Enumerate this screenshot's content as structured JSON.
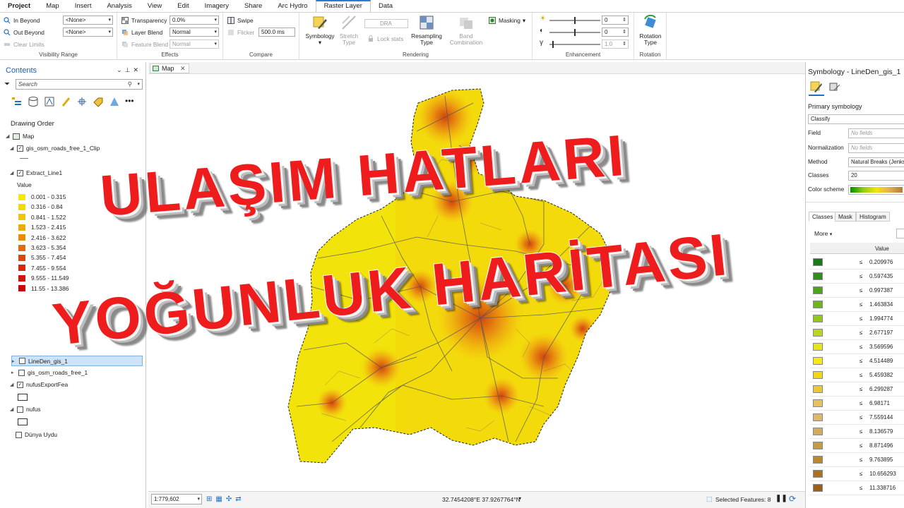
{
  "ribbon": {
    "tabs": [
      "Project",
      "Map",
      "Insert",
      "Analysis",
      "View",
      "Edit",
      "Imagery",
      "Share",
      "Arc Hydro",
      "Raster Layer",
      "Data"
    ],
    "active_tab": "Raster Layer",
    "visibility": {
      "in_beyond_label": "In Beyond",
      "in_beyond_value": "<None>",
      "out_beyond_label": "Out Beyond",
      "out_beyond_value": "<None>",
      "clear_limits": "Clear Limits",
      "group_label": "Visibility Range"
    },
    "effects": {
      "transparency_label": "Transparency",
      "transparency_value": "0.0%",
      "layer_blend_label": "Layer Blend",
      "layer_blend_value": "Normal",
      "feature_blend_label": "Feature Blend",
      "feature_blend_value": "Normal",
      "group_label": "Effects"
    },
    "compare": {
      "swipe": "Swipe",
      "flicker_label": "Flicker",
      "flicker_value": "500.0",
      "flicker_unit": "ms",
      "group_label": "Compare"
    },
    "rendering": {
      "symbology": "Symbology",
      "stretch_1": "Stretch",
      "stretch_2": "Type",
      "dra": "DRA",
      "lock_stats": "Lock stats",
      "resampling_1": "Resampling",
      "resampling_2": "Type",
      "band_1": "Band",
      "band_2": "Combination",
      "masking": "Masking",
      "group_label": "Rendering"
    },
    "enhancement": {
      "v1": "0",
      "v2": "0",
      "v3": "1.0",
      "group_label": "Enhancement"
    },
    "rotation": {
      "label_1": "Rotation",
      "label_2": "Type",
      "group_label": "Rotation"
    }
  },
  "contents": {
    "title": "Contents",
    "search_placeholder": "Search",
    "drawing_order": "Drawing Order",
    "map_label": "Map",
    "layers": {
      "roads_clip": "gis_osm_roads_free_1_Clip",
      "extract": "Extract_Line1",
      "value_label": "Value",
      "legend": [
        {
          "label": "0.001 - 0.315",
          "color": "#f5e90c"
        },
        {
          "label": "0.316 - 0.84",
          "color": "#f2d80c"
        },
        {
          "label": "0.841 - 1.522",
          "color": "#efc40c"
        },
        {
          "label": "1.523 - 2.415",
          "color": "#ebab0c"
        },
        {
          "label": "2.416 - 3.622",
          "color": "#e78d0c"
        },
        {
          "label": "3.623 - 5.354",
          "color": "#e26b0b"
        },
        {
          "label": "5.355 - 7.454",
          "color": "#dc470b"
        },
        {
          "label": "7.455 - 9.554",
          "color": "#d6280b"
        },
        {
          "label": "9.555 - 11.549",
          "color": "#d1120b"
        },
        {
          "label": "11.55 - 13.386",
          "color": "#c7060b"
        }
      ],
      "linedens": "LineDen_gis_1",
      "roads": "gis_osm_roads_free_1",
      "nufus_export": "nufusExportFea",
      "nufus": "nufus",
      "basemap": "Dünya Uydu"
    }
  },
  "map": {
    "tab_label": "Map",
    "scale": "1:779,602",
    "coordinates": "32.7454208°E 37.9267764°N",
    "selected_features": "Selected Features: 8"
  },
  "overlay": {
    "line1": "ULAŞIM HATLARI",
    "line2": "YOĞUNLUK HARİTASI"
  },
  "symbology": {
    "title": "Symbology - LineDen_gis_1",
    "primary": "Primary symbology",
    "classify": "Classify",
    "field_label": "Field",
    "field_value": "No fields",
    "norm_label": "Normalization",
    "norm_value": "No fields",
    "method_label": "Method",
    "method_value": "Natural Breaks (Jenks)",
    "classes_label": "Classes",
    "classes_value": "20",
    "scheme_label": "Color scheme",
    "tabs": [
      "Classes",
      "Mask",
      "Histogram"
    ],
    "more": "More",
    "value_header": "Value",
    "class_rows": [
      {
        "le": "≤",
        "value": "0.209976",
        "color": "#1a7a1a"
      },
      {
        "le": "≤",
        "value": "0.597435",
        "color": "#2f8f1a"
      },
      {
        "le": "≤",
        "value": "0.997387",
        "color": "#4da31a"
      },
      {
        "le": "≤",
        "value": "1.463834",
        "color": "#6db51a"
      },
      {
        "le": "≤",
        "value": "1.994774",
        "color": "#93c71a"
      },
      {
        "le": "≤",
        "value": "2.677197",
        "color": "#bcd71a"
      },
      {
        "le": "≤",
        "value": "3.569596",
        "color": "#e3e61a"
      },
      {
        "le": "≤",
        "value": "4.514489",
        "color": "#f5ea14"
      },
      {
        "le": "≤",
        "value": "5.459382",
        "color": "#f2d813"
      },
      {
        "le": "≤",
        "value": "6.299287",
        "color": "#eec63c"
      },
      {
        "le": "≤",
        "value": "6.98171",
        "color": "#e4c25c"
      },
      {
        "le": "≤",
        "value": "7.559144",
        "color": "#dbb86a"
      },
      {
        "le": "≤",
        "value": "8.136579",
        "color": "#d2ac5c"
      },
      {
        "le": "≤",
        "value": "8.871496",
        "color": "#c79a44"
      },
      {
        "le": "≤",
        "value": "9.763895",
        "color": "#b9872e"
      },
      {
        "le": "≤",
        "value": "10.656293",
        "color": "#aa7220"
      },
      {
        "le": "≤",
        "value": "11.338716",
        "color": "#9b6018"
      }
    ]
  }
}
